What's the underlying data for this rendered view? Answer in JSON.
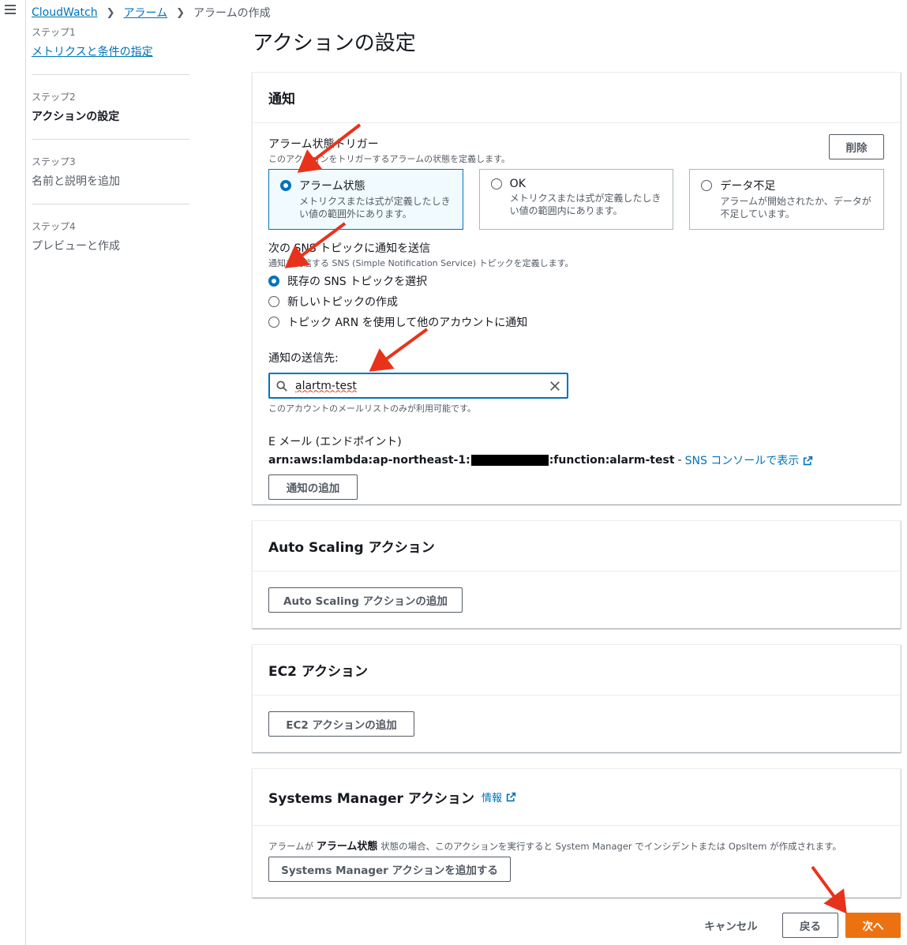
{
  "breadcrumb": {
    "root": "CloudWatch",
    "alarms": "アラーム",
    "current": "アラームの作成"
  },
  "steps": [
    {
      "num": "ステップ1",
      "label": "メトリクスと条件の指定"
    },
    {
      "num": "ステップ2",
      "label": "アクションの設定"
    },
    {
      "num": "ステップ3",
      "label": "名前と説明を追加"
    },
    {
      "num": "ステップ4",
      "label": "プレビューと作成"
    }
  ],
  "page_title": "アクションの設定",
  "notification": {
    "title": "通知",
    "trigger_label": "アラーム状態トリガー",
    "trigger_desc": "このアクションをトリガーするアラームの状態を定義します。",
    "remove_label": "削除",
    "tiles": [
      {
        "title": "アラーム状態",
        "desc": "メトリクスまたは式が定義したしきい値の範囲外にあります。",
        "selected": true
      },
      {
        "title": "OK",
        "desc": "メトリクスまたは式が定義したしきい値の範囲内にあります。",
        "selected": false
      },
      {
        "title": "データ不足",
        "desc": "アラームが開始されたか、データが不足しています。",
        "selected": false
      }
    ],
    "sns_label": "次の SNS トピックに通知を送信",
    "sns_desc": "通知を受信する SNS (Simple Notification Service) トピックを定義します。",
    "sns_options": [
      {
        "label": "既存の SNS トピックを選択",
        "selected": true
      },
      {
        "label": "新しいトピックの作成",
        "selected": false
      },
      {
        "label": "トピック ARN を使用して他のアカウントに通知",
        "selected": false
      }
    ],
    "send_to_label": "通知の送信先:",
    "search_value": "alartm-test",
    "search_hint": "このアカウントのメールリストのみが利用可能です。",
    "endpoint_label": "E メール (エンドポイント)",
    "endpoint_prefix": "arn:aws:lambda:ap-northeast-1:",
    "endpoint_suffix": ":function:alarm-test",
    "endpoint_dash": "-",
    "endpoint_link": "SNS コンソールで表示",
    "add_notification": "通知の追加"
  },
  "autoscaling": {
    "title": "Auto Scaling アクション",
    "add_button": "Auto Scaling アクションの追加"
  },
  "ec2": {
    "title": "EC2 アクション",
    "add_button": "EC2 アクションの追加"
  },
  "ssm": {
    "title": "Systems Manager アクション",
    "info": "情報",
    "desc_pre": "アラームが",
    "desc_bold": "アラーム状態",
    "desc_post": "状態の場合、このアクションを実行すると System Manager でインシデントまたは OpsItem が作成されます。",
    "add_button": "Systems Manager アクションを追加する"
  },
  "footer": {
    "cancel": "キャンセル",
    "back": "戻る",
    "next": "次へ"
  },
  "colors": {
    "link": "#0073bb",
    "primary": "#ec7211",
    "annotation_arrow": "#e8331c"
  }
}
